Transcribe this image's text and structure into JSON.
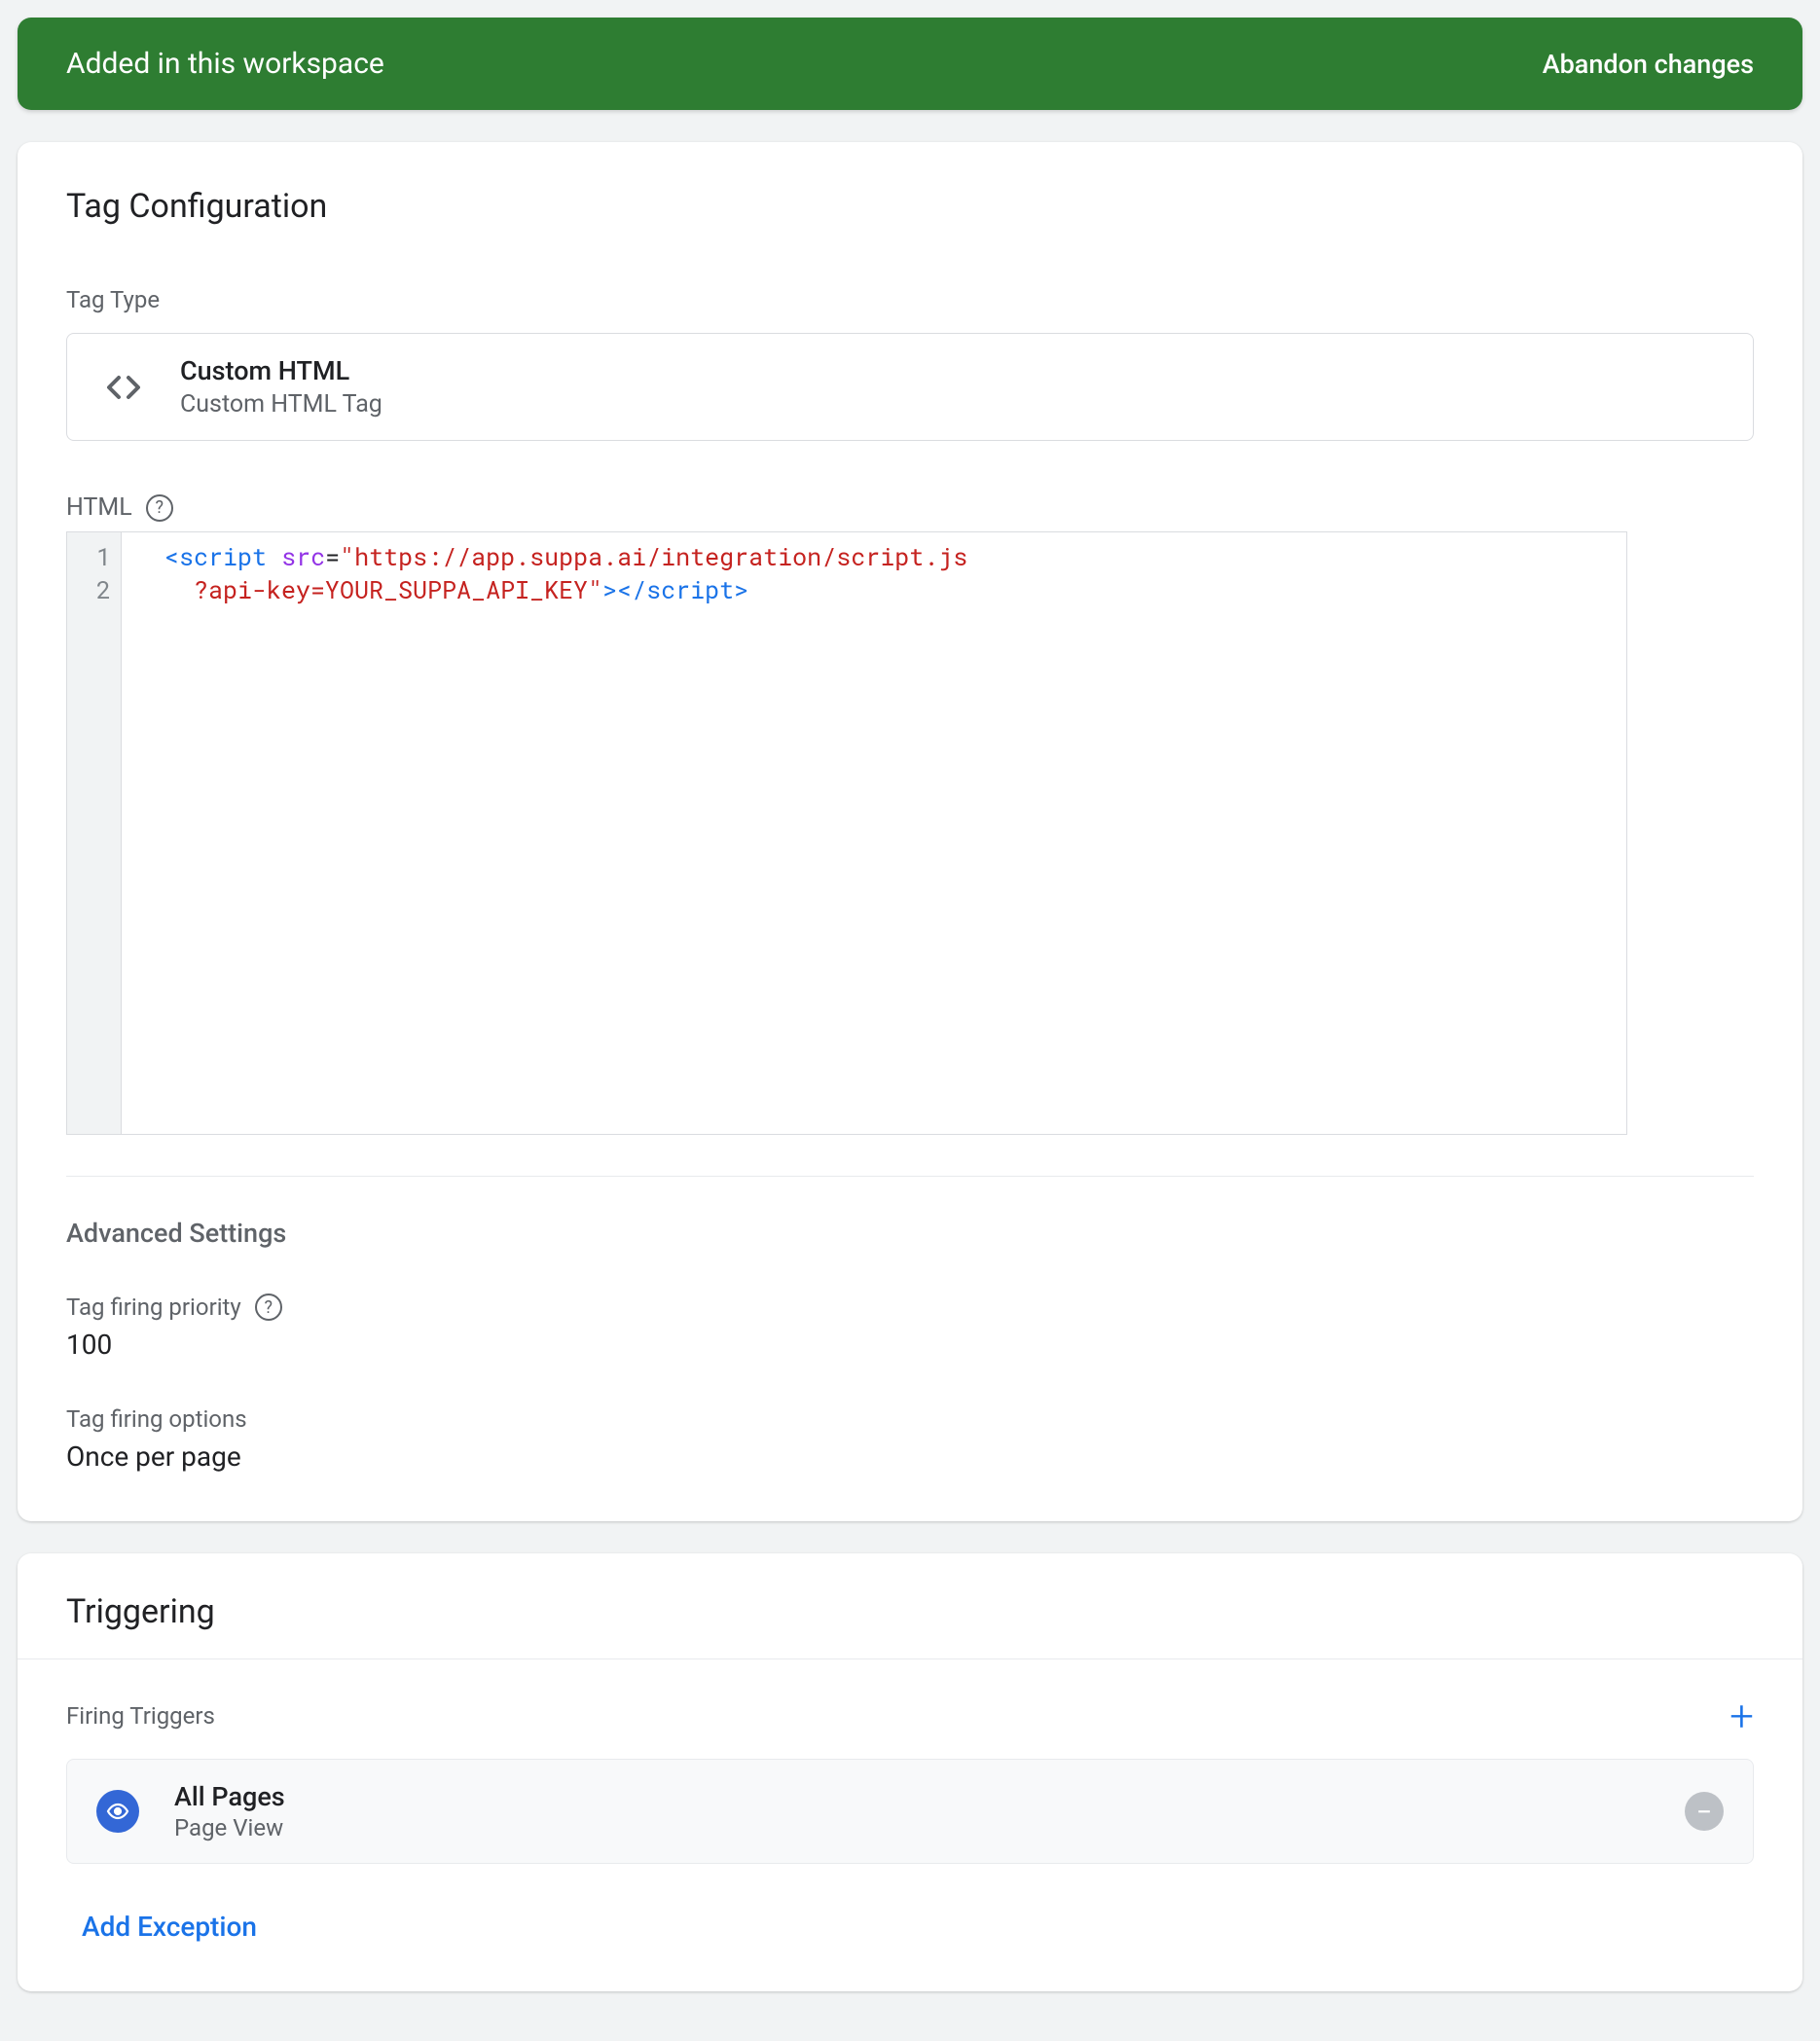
{
  "banner": {
    "message": "Added in this workspace",
    "abandon_label": "Abandon changes"
  },
  "config": {
    "title": "Tag Configuration",
    "tag_type_label": "Tag Type",
    "tag_type_name": "Custom HTML",
    "tag_type_desc": "Custom HTML Tag",
    "html_label": "HTML",
    "code_lines": [
      "1",
      "2"
    ],
    "code_tokens": {
      "l1_open": "<",
      "l1_tag": "script",
      "l1_attr": "src",
      "l1_eq": "=",
      "l1_str_open": "\"",
      "l1_str_part1": "https://app.suppa.ai/integration/script.js",
      "l2_str_part2": "?api-key=YOUR_SUPPA_API_KEY",
      "l2_str_close": "\"",
      "l2_close_open": ">",
      "l2_end_open": "</",
      "l2_end_tag": "script",
      "l2_end_close": ">"
    },
    "advanced_title": "Advanced Settings",
    "priority_label": "Tag firing priority",
    "priority_value": "100",
    "options_label": "Tag firing options",
    "options_value": "Once per page"
  },
  "triggering": {
    "title": "Triggering",
    "firing_label": "Firing Triggers",
    "trigger_name": "All Pages",
    "trigger_type": "Page View",
    "add_exception": "Add Exception"
  }
}
